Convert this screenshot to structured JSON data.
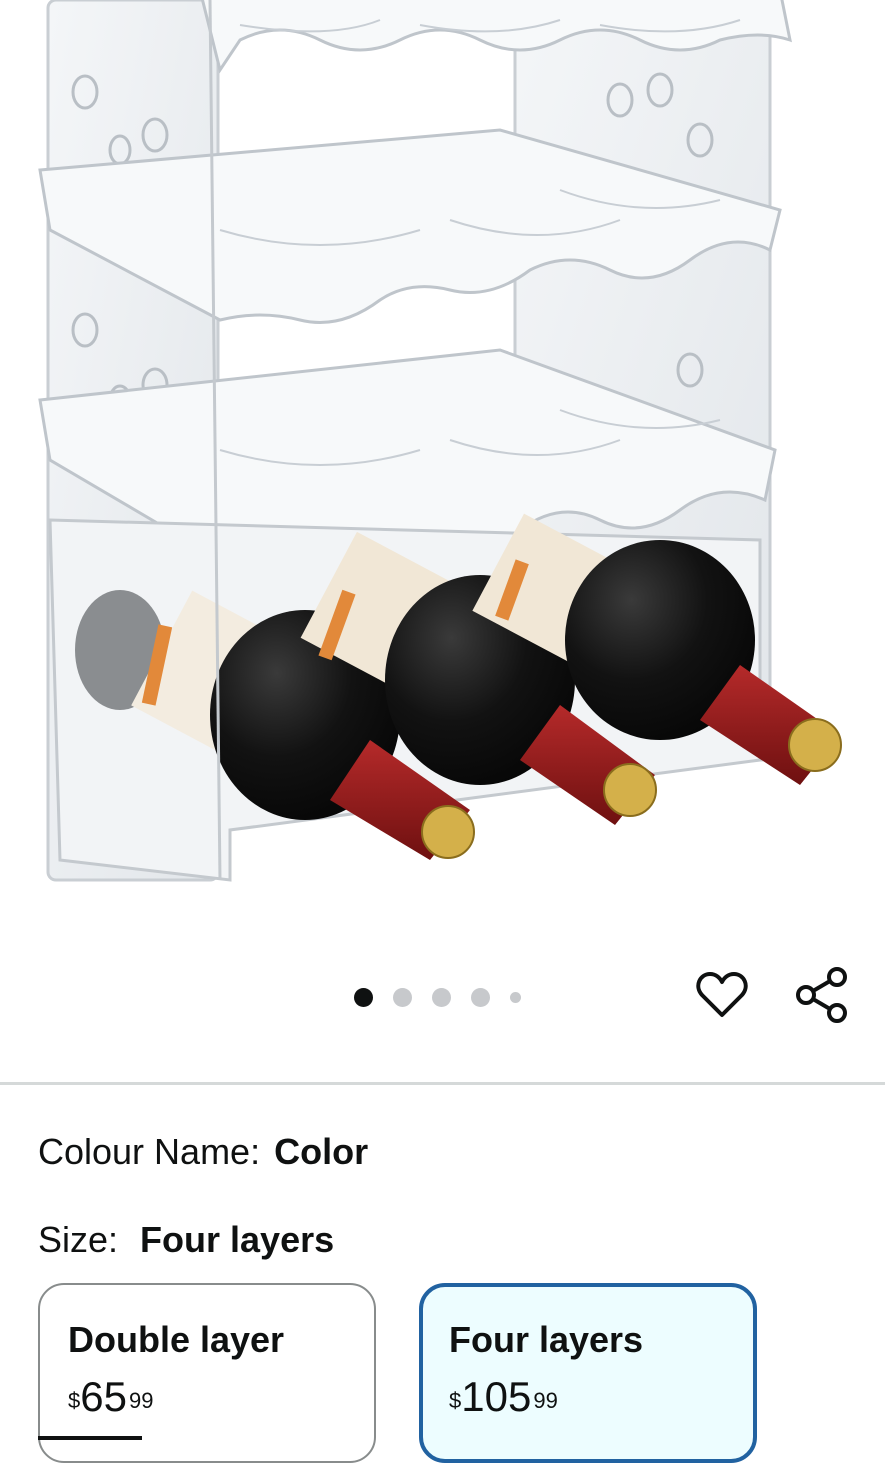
{
  "product": {
    "image_alt": "Stackable clear acrylic wine rack with four layers holding three red wine bottles",
    "image_count": 5,
    "active_image_index": 0
  },
  "actions": {
    "wishlist_icon": "heart-outline-icon",
    "share_icon": "share-icon"
  },
  "colour": {
    "label": "Colour Name:",
    "value": "Color"
  },
  "size": {
    "label": "Size:",
    "value": "Four layers",
    "options": [
      {
        "title": "Double layer",
        "currency": "$",
        "whole": "65",
        "fraction": "99",
        "selected": false
      },
      {
        "title": "Four layers",
        "currency": "$",
        "whole": "105",
        "fraction": "99",
        "selected": true
      }
    ]
  },
  "colors": {
    "accent_border": "#2162a1",
    "selected_bg": "#edfdff",
    "dot_active": "#0f1111",
    "dot_inactive": "#c7c9cc",
    "wine_capsule": "#8e1a1a"
  }
}
